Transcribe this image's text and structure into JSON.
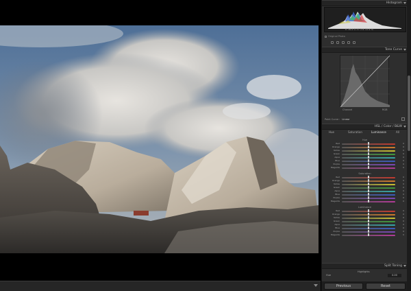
{
  "app": {
    "accent": "#1a1a1a"
  },
  "photo": {
    "subject": "mountain-landscape"
  },
  "panel": {
    "histogram": {
      "title": "Histogram",
      "values": "R  36.4   G  37.3   B  33.4 %",
      "original_photo": "Original Photo"
    },
    "tone_curve": {
      "title": "Tone Curve",
      "cap_left": "Channel",
      "cap_right": "RGB",
      "point_curve_label": "Point Curve :",
      "point_curve_value": "Linear"
    },
    "hsl": {
      "title": "HSL / Color / B&W",
      "tabs": [
        "Hue",
        "Saturation",
        "Luminance",
        "All"
      ],
      "sections": [
        {
          "label": "Hue",
          "rows": [
            "Red",
            "Orange",
            "Yellow",
            "Green",
            "Aqua",
            "Blue",
            "Purple",
            "Magenta"
          ]
        },
        {
          "label": "Saturation",
          "rows": [
            "Red",
            "Orange",
            "Yellow",
            "Green",
            "Aqua",
            "Blue",
            "Purple",
            "Magenta"
          ]
        },
        {
          "label": "Luminance",
          "rows": [
            "Red",
            "Orange",
            "Yellow",
            "Green",
            "Aqua",
            "Blue",
            "Purple",
            "Magenta"
          ]
        }
      ],
      "row_value": "0"
    },
    "split_toning": {
      "title": "Split Toning",
      "highlights_label": "Highlights",
      "hue_label": "Hue",
      "hue_value": "0.00"
    },
    "buttons": {
      "previous": "Previous",
      "reset": "Reset"
    }
  },
  "colors": {
    "Red": "#c23a2e",
    "Orange": "#cf7a28",
    "Yellow": "#c9c12f",
    "Green": "#3f9a3a",
    "Aqua": "#34a7a8",
    "Blue": "#3a5bbd",
    "Purple": "#7a46b8",
    "Magenta": "#b23a98"
  }
}
